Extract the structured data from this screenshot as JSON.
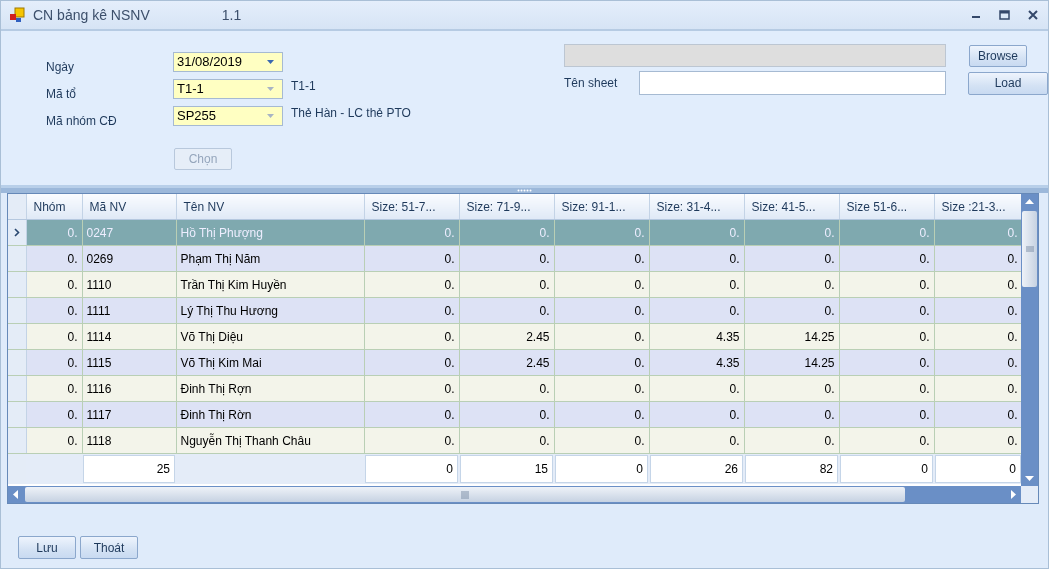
{
  "window": {
    "title": "CN bảng kê NSNV",
    "version": "1.1"
  },
  "form": {
    "fields": [
      {
        "label": "Ngày",
        "value": "31/08/2019",
        "disabled": false
      },
      {
        "label": "Mã tổ",
        "value": "T1-1",
        "disabled": true,
        "note": "T1-1"
      },
      {
        "label": "Mã nhóm CĐ",
        "value": "SP255",
        "disabled": true,
        "note": "Thẻ Hàn - LC thẻ PTO"
      }
    ],
    "choose_button": {
      "label": "Chọn",
      "disabled": true
    },
    "sheet_label": "Tên sheet",
    "browse_button": "Browse",
    "load_button": "Load"
  },
  "table": {
    "columns": [
      "Nhóm",
      "Mã NV",
      "Tên NV",
      "Size: 51-7...",
      "Size: 71-9...",
      "Size: 91-1...",
      "Size: 31-4...",
      "Size: 41-5...",
      "Size 51-6...",
      "Size :21-3..."
    ],
    "rows": [
      {
        "selected": true,
        "cells": [
          "0.",
          "0247",
          "Hồ Thị Phượng",
          "0.",
          "0.",
          "0.",
          "0.",
          "0.",
          "0.",
          "0."
        ]
      },
      {
        "selected": false,
        "cells": [
          "0.",
          "0269",
          "Phạm Thị Năm",
          "0.",
          "0.",
          "0.",
          "0.",
          "0.",
          "0.",
          "0."
        ]
      },
      {
        "selected": false,
        "cells": [
          "0.",
          "1110",
          "Trần Thị Kim  Huyền",
          "0.",
          "0.",
          "0.",
          "0.",
          "0.",
          "0.",
          "0."
        ]
      },
      {
        "selected": false,
        "cells": [
          "0.",
          "1111",
          "Lý Thị Thu  Hương",
          "0.",
          "0.",
          "0.",
          "0.",
          "0.",
          "0.",
          "0."
        ]
      },
      {
        "selected": false,
        "cells": [
          "0.",
          "1114",
          "Võ Thị  Diệu",
          "0.",
          "2.45",
          "0.",
          "4.35",
          "14.25",
          "0.",
          "0."
        ]
      },
      {
        "selected": false,
        "cells": [
          "0.",
          "1115",
          "Võ Thị Kim Mai",
          "0.",
          "2.45",
          "0.",
          "4.35",
          "14.25",
          "0.",
          "0."
        ]
      },
      {
        "selected": false,
        "cells": [
          "0.",
          "1116",
          "Đinh Thị  Rợn",
          "0.",
          "0.",
          "0.",
          "0.",
          "0.",
          "0.",
          "0."
        ]
      },
      {
        "selected": false,
        "cells": [
          "0.",
          "1117",
          "Đinh Thị  Rờn",
          "0.",
          "0.",
          "0.",
          "0.",
          "0.",
          "0.",
          "0."
        ]
      },
      {
        "selected": false,
        "cells": [
          "0.",
          "1118",
          "Nguyễn Thị Thanh  Châu",
          "0.",
          "0.",
          "0.",
          "0.",
          "0.",
          "0.",
          "0."
        ]
      }
    ],
    "totals": {
      "ma_nv": "25",
      "sizes": [
        "0",
        "15",
        "0",
        "26",
        "82",
        "0",
        "0"
      ]
    }
  },
  "buttons": [
    "Lưu",
    "Thoát"
  ]
}
